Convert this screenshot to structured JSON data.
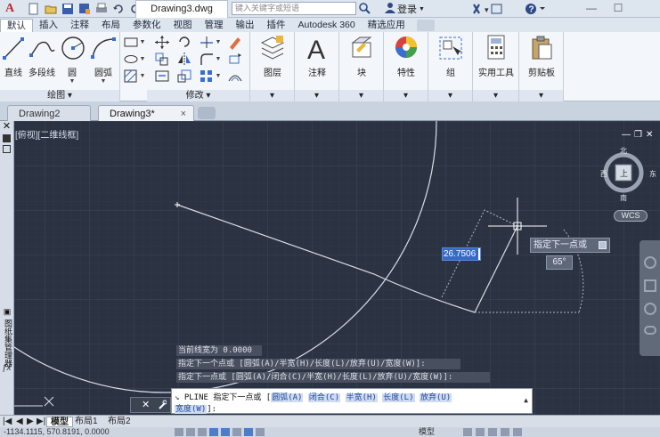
{
  "titlebar": {
    "app_logo": "A",
    "document_title": "Drawing3.dwg",
    "search_placeholder": "键入关键字或短语",
    "login_label": "登录",
    "window_minimize": "—",
    "window_restore": "☐"
  },
  "ribbon_tabs": [
    "默认",
    "插入",
    "注释",
    "布局",
    "参数化",
    "视图",
    "管理",
    "输出",
    "插件",
    "Autodesk 360",
    "精选应用"
  ],
  "ribbon": {
    "draw_panel": {
      "title": "绘图",
      "line": "直线",
      "polyline": "多段线",
      "circle": "圆",
      "arc": "圆弧"
    },
    "modify_panel": {
      "title": "修改"
    },
    "layers": "图层",
    "annotation": "注释",
    "block": "块",
    "properties": "特性",
    "groups": "组",
    "utilities": "实用工具",
    "clipboard": "剪贴板"
  },
  "doc_tabs": [
    {
      "label": "Drawing2",
      "active": false
    },
    {
      "label": "Drawing3*",
      "active": true
    }
  ],
  "drawing": {
    "viewport_label": "[俯视][二维线框]",
    "dynamic_input_value": "26.7506",
    "tooltip_text": "指定下一点或",
    "angle_value": "65°",
    "viewcube": {
      "north": "北",
      "south": "南",
      "west": "西",
      "east": "东",
      "face": "上"
    },
    "wcs_label": "WCS",
    "left_strip_text": "▣ 图纸集管理器"
  },
  "command": {
    "history": [
      "当前线宽为 0.0000",
      "指定下一个点或 [圆弧(A)/半宽(H)/长度(L)/放弃(U)/宽度(W)]:",
      "指定下一点或 [圆弧(A)/闭合(C)/半宽(H)/长度(L)/放弃(U)/宽度(W)]:"
    ],
    "prompt_prefix": "PLINE 指定下一点或 [",
    "options": [
      "圆弧(A)",
      "闭合(C)",
      "半宽(H)",
      "长度(L)",
      "放弃(U)"
    ],
    "line2_option": "宽度(W)",
    "line2_suffix": "]:"
  },
  "layout_tabs": [
    "模型",
    "布局1",
    "布局2"
  ],
  "statusbar": {
    "coordinates": "-1134.1115, 570.8191, 0.0000",
    "model_label": "模型"
  },
  "colors": {
    "canvas_bg": "#2b3343",
    "grid_minor": "#343c4c",
    "grid_major": "#3d4658",
    "drawing_line": "#d9dee6",
    "accent": "#3769c9"
  }
}
